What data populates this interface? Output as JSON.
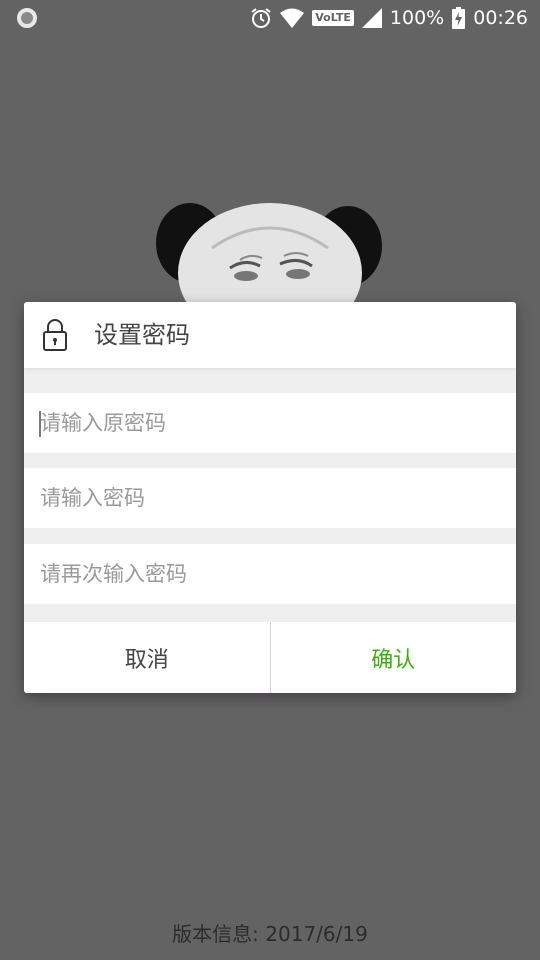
{
  "status_bar": {
    "volte": "VoLTE",
    "battery": "100%",
    "time": "00:26"
  },
  "dialog": {
    "title": "设置密码",
    "fields": [
      {
        "placeholder": "请输入原密码"
      },
      {
        "placeholder": "请输入密码"
      },
      {
        "placeholder": "请再次输入密码"
      }
    ],
    "cancel_label": "取消",
    "confirm_label": "确认"
  },
  "footer": {
    "version": "版本信息: 2017/6/19"
  },
  "colors": {
    "background": "#646364",
    "confirm": "#3fae12"
  },
  "icons": [
    "status-circle-icon",
    "alarm-icon",
    "wifi-icon",
    "signal-icon",
    "battery-icon",
    "lock-icon"
  ]
}
